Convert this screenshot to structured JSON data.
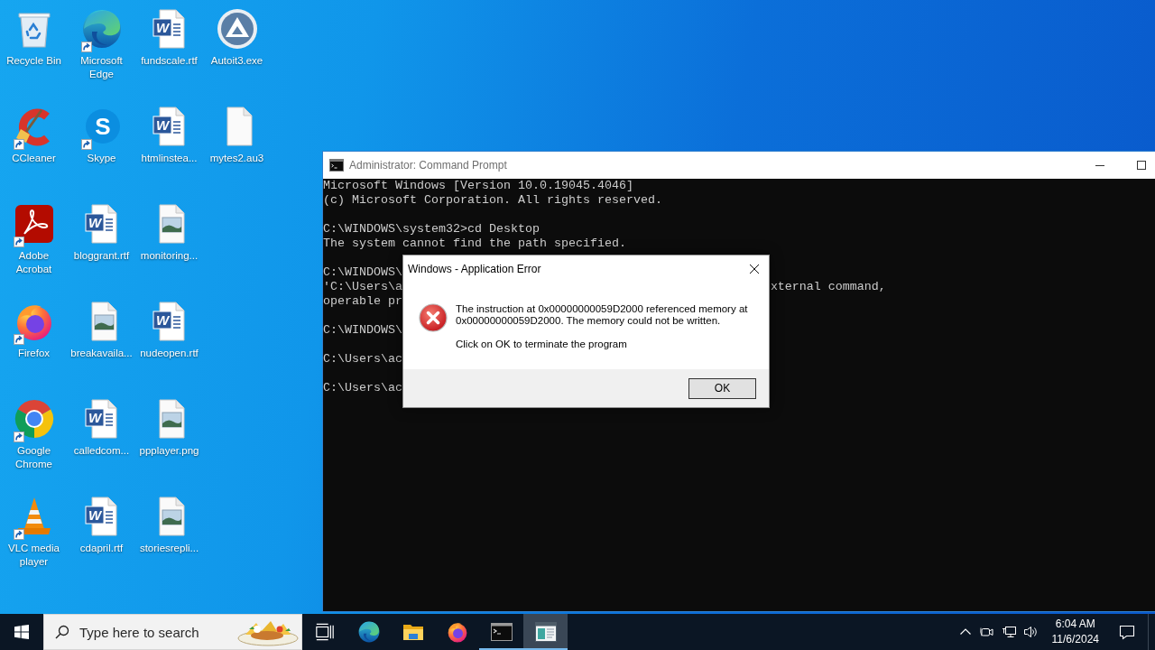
{
  "desktop": {
    "icons": [
      {
        "label": "Recycle Bin",
        "kind": "recycle-bin",
        "shortcut": false
      },
      {
        "label": "CCleaner",
        "kind": "ccleaner",
        "shortcut": true
      },
      {
        "label": "Adobe Acrobat",
        "kind": "acrobat",
        "shortcut": true
      },
      {
        "label": "Firefox",
        "kind": "firefox",
        "shortcut": true
      },
      {
        "label": "Google Chrome",
        "kind": "chrome",
        "shortcut": true
      },
      {
        "label": "VLC media player",
        "kind": "vlc",
        "shortcut": true
      },
      {
        "label": "Microsoft Edge",
        "kind": "edge",
        "shortcut": true
      },
      {
        "label": "Skype",
        "kind": "skype",
        "shortcut": true,
        "glyph": "S"
      },
      {
        "label": "bloggrant.rtf",
        "kind": "word",
        "shortcut": false,
        "glyph": "W"
      },
      {
        "label": "breakavaila...",
        "kind": "image",
        "shortcut": false
      },
      {
        "label": "calledcom...",
        "kind": "word",
        "shortcut": false,
        "glyph": "W"
      },
      {
        "label": "cdapril.rtf",
        "kind": "word",
        "shortcut": false,
        "glyph": "W"
      },
      {
        "label": "fundscale.rtf",
        "kind": "word",
        "shortcut": false,
        "glyph": "W"
      },
      {
        "label": "htmlinstea...",
        "kind": "word",
        "shortcut": false,
        "glyph": "W"
      },
      {
        "label": "monitoring...",
        "kind": "image",
        "shortcut": false
      },
      {
        "label": "nudeopen.rtf",
        "kind": "word",
        "shortcut": false,
        "glyph": "W"
      },
      {
        "label": "ppplayer.png",
        "kind": "image",
        "shortcut": false
      },
      {
        "label": "storiesrepli...",
        "kind": "image",
        "shortcut": false
      },
      {
        "label": "Autoit3.exe",
        "kind": "autoit",
        "shortcut": false
      },
      {
        "label": "mytes2.au3",
        "kind": "file",
        "shortcut": false
      }
    ]
  },
  "console": {
    "title": "Administrator: Command Prompt",
    "blocks": [
      {
        "lines": [
          {
            "segments": [
              "Microsoft Windows [Version 10.0.19045.4046]"
            ]
          },
          {
            "segments": [
              "(c) Microsoft Corporation. All rights reserved."
            ]
          }
        ]
      },
      {
        "lines": [
          {
            "segments": [
              "C:\\WINDOWS\\system32>cd Desktop"
            ]
          },
          {
            "segments": [
              "The system cannot find the path specified."
            ]
          }
        ]
      },
      {
        "lines": [
          {
            "segments": [
              "C:\\WINDOWS\\"
            ]
          },
          {
            "segments": [
              "'C:\\Users\\a",
              "xternal command,"
            ]
          },
          {
            "segments": [
              "operable pr"
            ]
          }
        ]
      },
      {
        "lines": [
          {
            "segments": [
              "C:\\WINDOWS\\"
            ]
          }
        ]
      },
      {
        "lines": [
          {
            "segments": [
              "C:\\Users\\ac"
            ]
          }
        ]
      },
      {
        "lines": [
          {
            "segments": [
              "C:\\Users\\ac"
            ]
          }
        ]
      }
    ]
  },
  "dialog": {
    "title": "Windows - Application Error",
    "message": "The instruction at 0x00000000059D2000 referenced memory at 0x00000000059D2000. The memory could not be written.",
    "hint": "Click on OK to terminate the program",
    "buttons": [
      "OK"
    ]
  },
  "taskbar": {
    "search": {
      "placeholder": "Type here to search"
    },
    "apps": [
      {
        "kind": "edge",
        "running": false,
        "selected": false
      },
      {
        "kind": "explorer",
        "running": false,
        "selected": false
      },
      {
        "kind": "firefox",
        "running": false,
        "selected": false
      },
      {
        "kind": "cmd",
        "running": true,
        "selected": false
      },
      {
        "kind": "window",
        "running": true,
        "selected": true
      }
    ],
    "clock": {
      "time": "6:04 AM",
      "date": "11/6/2024"
    }
  }
}
